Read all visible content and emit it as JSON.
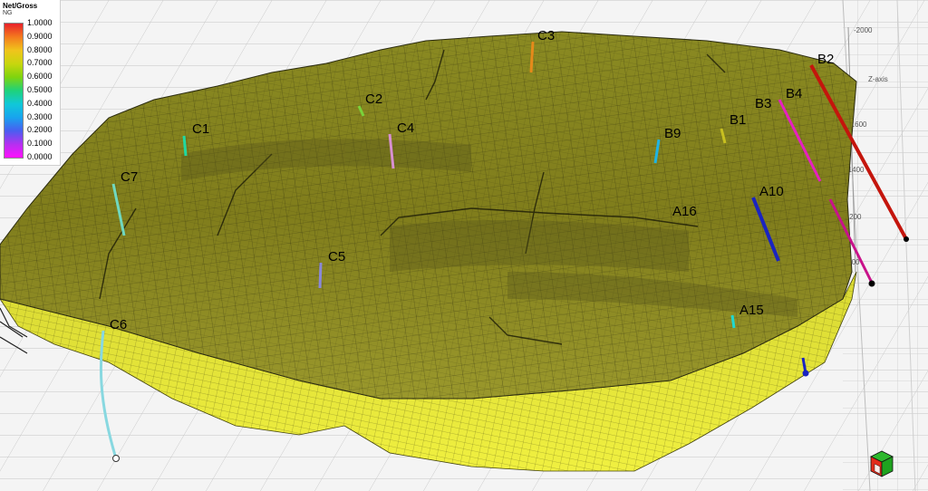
{
  "legend": {
    "title": "Net/Gross",
    "subtitle": "NG",
    "values": [
      "1.0000",
      "0.9000",
      "0.8000",
      "0.7000",
      "0.6000",
      "0.5000",
      "0.4000",
      "0.3000",
      "0.2000",
      "0.1000",
      "0.0000"
    ]
  },
  "axis": {
    "name": "Z-axis",
    "ticks": [
      "-2000",
      "-1800",
      "-1600",
      "-1400",
      "-1200",
      "-1000"
    ]
  },
  "wells": [
    {
      "name": "C3",
      "color": "#e58a1a"
    },
    {
      "name": "B2",
      "color": "#c4150c"
    },
    {
      "name": "C2",
      "color": "#7ad23a"
    },
    {
      "name": "B4",
      "color": "#e620c0"
    },
    {
      "name": "B3",
      "color": "#c8128a"
    },
    {
      "name": "C1",
      "color": "#20d8a0"
    },
    {
      "name": "C4",
      "color": "#d890d0"
    },
    {
      "name": "B1",
      "color": "#c8c020"
    },
    {
      "name": "B9",
      "color": "#1fb4e4"
    },
    {
      "name": "C7",
      "color": "#70d8c0"
    },
    {
      "name": "A10",
      "color": "#1a24c0"
    },
    {
      "name": "A16",
      "color": "#2a2a2a"
    },
    {
      "name": "C5",
      "color": "#8a88d8"
    },
    {
      "name": "A15",
      "color": "#20d8d0"
    },
    {
      "name": "C6",
      "color": "#88d8e0"
    }
  ],
  "colors": {
    "surface_fill": "#8f8d24",
    "surface_flank": "#e4e434",
    "grid_line": "#2b2b10",
    "background": "#f4f4f4"
  },
  "orientation_icon": "orientation-cube-icon"
}
